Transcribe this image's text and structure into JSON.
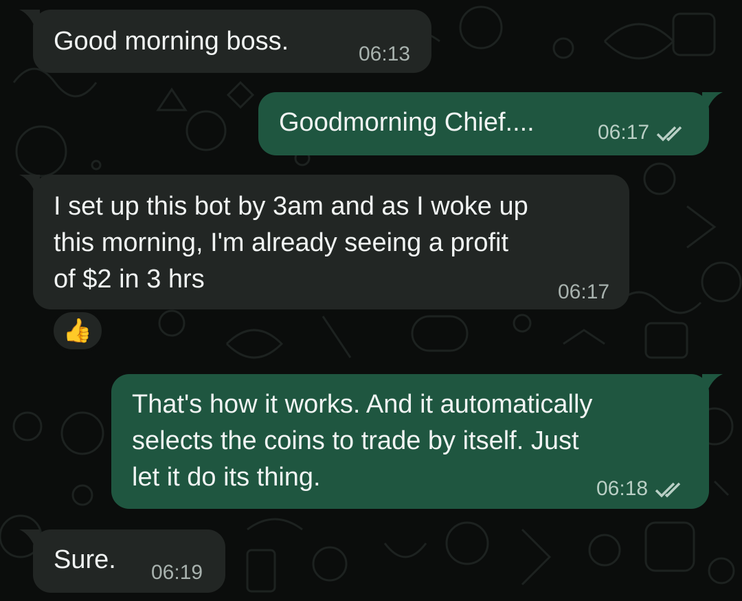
{
  "messages": [
    {
      "direction": "incoming",
      "text": "Good morning boss.",
      "time": "06:13"
    },
    {
      "direction": "outgoing",
      "text": "Goodmorning Chief....",
      "time": "06:17",
      "status": "read"
    },
    {
      "direction": "incoming",
      "lines": [
        "I set up this bot by 3am and as I woke up",
        "this morning, I'm already seeing a profit",
        "of $2 in 3 hrs"
      ],
      "time": "06:17",
      "reaction": "👍"
    },
    {
      "direction": "outgoing",
      "lines": [
        "That's how it works. And it automatically",
        "selects the coins to trade by itself. Just",
        "let it do its thing."
      ],
      "time": "06:18",
      "status": "read"
    },
    {
      "direction": "incoming",
      "text": "Sure.",
      "time": "06:19"
    }
  ],
  "colors": {
    "incoming_bubble": "#222624",
    "outgoing_bubble": "#1f5640",
    "background": "#0b0d0c"
  },
  "icons": {
    "read_receipt": "double-check-icon"
  }
}
